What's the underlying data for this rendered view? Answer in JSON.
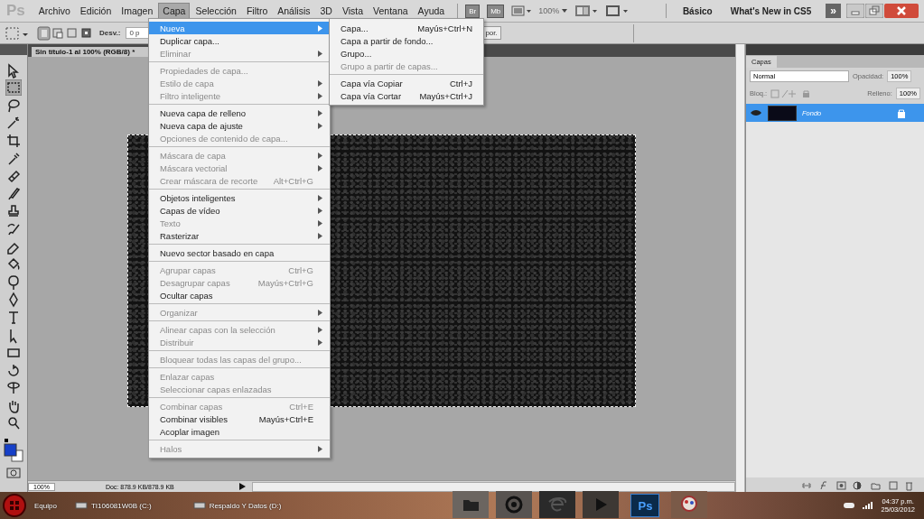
{
  "app_logo": "Ps",
  "menubar": [
    {
      "label": "Archivo",
      "selected": false
    },
    {
      "label": "Edición",
      "selected": false
    },
    {
      "label": "Imagen",
      "selected": false
    },
    {
      "label": "Capa",
      "selected": true
    },
    {
      "label": "Selección",
      "selected": false
    },
    {
      "label": "Filtro",
      "selected": false
    },
    {
      "label": "Análisis",
      "selected": false
    },
    {
      "label": "3D",
      "selected": false
    },
    {
      "label": "Vista",
      "selected": false
    },
    {
      "label": "Ventana",
      "selected": false
    },
    {
      "label": "Ayuda",
      "selected": false
    }
  ],
  "app_bar": {
    "bridge": "Br",
    "mini_bridge": "Mb",
    "zoom": "100%",
    "workspaces": [
      "Básico",
      "What's New in CS5"
    ],
    "more": "»"
  },
  "options_bar": {
    "feather_label": "Desv.:",
    "feather_value": "0 p",
    "refine_button": "por."
  },
  "document": {
    "tab": "Sin título-1 al 100% (RGB/8) *",
    "zoom": "100%",
    "doc_info": "Doc: 878.9 KB/878.9 KB"
  },
  "tools": [
    {
      "kind": "move",
      "selected": false
    },
    {
      "kind": "marquee",
      "selected": true
    },
    {
      "kind": "lasso",
      "selected": false
    },
    {
      "kind": "wand",
      "selected": false
    },
    {
      "kind": "crop",
      "selected": false
    },
    {
      "kind": "eyedropper",
      "selected": false
    },
    {
      "kind": "healing",
      "selected": false
    },
    {
      "kind": "brush",
      "selected": false
    },
    {
      "kind": "stamp",
      "selected": false
    },
    {
      "kind": "history",
      "selected": false
    },
    {
      "kind": "eraser",
      "selected": false
    },
    {
      "kind": "bucket",
      "selected": false
    },
    {
      "kind": "dodge",
      "selected": false
    },
    {
      "kind": "pen",
      "selected": false
    },
    {
      "kind": "text",
      "selected": false
    },
    {
      "kind": "arrow",
      "selected": false
    },
    {
      "kind": "shape",
      "selected": false
    },
    {
      "kind": "rotate",
      "selected": false
    },
    {
      "kind": "orbit",
      "selected": false
    },
    {
      "kind": "hand",
      "selected": false
    },
    {
      "kind": "zoom",
      "selected": false
    }
  ],
  "menu": [
    [
      {
        "label": "Nueva",
        "submenu": true,
        "disabled": false,
        "selected": true
      },
      {
        "label": "Duplicar capa...",
        "submenu": false,
        "disabled": false,
        "selected": false
      },
      {
        "label": "Eliminar",
        "submenu": true,
        "disabled": true,
        "selected": false
      }
    ],
    [
      {
        "label": "Propiedades de capa...",
        "submenu": false,
        "disabled": true,
        "selected": false
      },
      {
        "label": "Estilo de capa",
        "submenu": true,
        "disabled": true,
        "selected": false
      },
      {
        "label": "Filtro inteligente",
        "submenu": true,
        "disabled": true,
        "selected": false
      }
    ],
    [
      {
        "label": "Nueva capa de relleno",
        "submenu": true,
        "disabled": false,
        "selected": false
      },
      {
        "label": "Nueva capa de ajuste",
        "submenu": true,
        "disabled": false,
        "selected": false
      },
      {
        "label": "Opciones de contenido de capa...",
        "submenu": false,
        "disabled": true,
        "selected": false
      }
    ],
    [
      {
        "label": "Máscara de capa",
        "submenu": true,
        "disabled": true,
        "selected": false
      },
      {
        "label": "Máscara vectorial",
        "submenu": true,
        "disabled": true,
        "selected": false
      },
      {
        "label": "Crear máscara de recorte",
        "shortcut": "Alt+Ctrl+G",
        "submenu": false,
        "disabled": true,
        "selected": false
      }
    ],
    [
      {
        "label": "Objetos inteligentes",
        "submenu": true,
        "disabled": false,
        "selected": false
      },
      {
        "label": "Capas de vídeo",
        "submenu": true,
        "disabled": false,
        "selected": false
      },
      {
        "label": "Texto",
        "submenu": true,
        "disabled": true,
        "selected": false
      },
      {
        "label": "Rasterizar",
        "submenu": true,
        "disabled": false,
        "selected": false
      }
    ],
    [
      {
        "label": "Nuevo sector basado en capa",
        "submenu": false,
        "disabled": false,
        "selected": false
      }
    ],
    [
      {
        "label": "Agrupar capas",
        "shortcut": "Ctrl+G",
        "submenu": false,
        "disabled": true,
        "selected": false
      },
      {
        "label": "Desagrupar capas",
        "shortcut": "Mayús+Ctrl+G",
        "submenu": false,
        "disabled": true,
        "selected": false
      },
      {
        "label": "Ocultar capas",
        "submenu": false,
        "disabled": false,
        "selected": false
      }
    ],
    [
      {
        "label": "Organizar",
        "submenu": true,
        "disabled": true,
        "selected": false
      }
    ],
    [
      {
        "label": "Alinear capas con la selección",
        "submenu": true,
        "disabled": true,
        "selected": false
      },
      {
        "label": "Distribuir",
        "submenu": true,
        "disabled": true,
        "selected": false
      }
    ],
    [
      {
        "label": "Bloquear todas las capas del grupo...",
        "submenu": false,
        "disabled": true,
        "selected": false
      }
    ],
    [
      {
        "label": "Enlazar capas",
        "submenu": false,
        "disabled": true,
        "selected": false
      },
      {
        "label": "Seleccionar capas enlazadas",
        "submenu": false,
        "disabled": true,
        "selected": false
      }
    ],
    [
      {
        "label": "Combinar capas",
        "shortcut": "Ctrl+E",
        "submenu": false,
        "disabled": true,
        "selected": false
      },
      {
        "label": "Combinar visibles",
        "shortcut": "Mayús+Ctrl+E",
        "submenu": false,
        "disabled": false,
        "selected": false
      },
      {
        "label": "Acoplar imagen",
        "submenu": false,
        "disabled": false,
        "selected": false
      }
    ],
    [
      {
        "label": "Halos",
        "submenu": true,
        "disabled": true,
        "selected": false
      }
    ]
  ],
  "submenu": [
    [
      {
        "label": "Capa...",
        "shortcut": "Mayús+Ctrl+N",
        "disabled": false
      },
      {
        "label": "Capa a partir de fondo...",
        "disabled": false
      },
      {
        "label": "Grupo...",
        "disabled": false
      },
      {
        "label": "Grupo a partir de capas...",
        "disabled": true
      }
    ],
    [
      {
        "label": "Capa vía Copiar",
        "shortcut": "Ctrl+J",
        "disabled": false
      },
      {
        "label": "Capa vía Cortar",
        "shortcut": "Mayús+Ctrl+J",
        "disabled": false
      }
    ]
  ],
  "layers_panel": {
    "tab": "Capas",
    "blend_mode": "Normal",
    "opacity_label": "Opacidad:",
    "opacity": "100%",
    "lock_label": "Bloq.:",
    "fill_label": "Relleno:",
    "fill": "100%",
    "layers": [
      {
        "name": "Fondo",
        "selected": true,
        "visible": true,
        "locked": true
      }
    ]
  },
  "taskbar": {
    "items": [
      "Equipo",
      "TI106081W0B (C:)",
      "Respaldo Y Datos (D:)"
    ],
    "ps_label": "Ps",
    "time": "04:37 p.m.",
    "date": "25/03/2012"
  }
}
